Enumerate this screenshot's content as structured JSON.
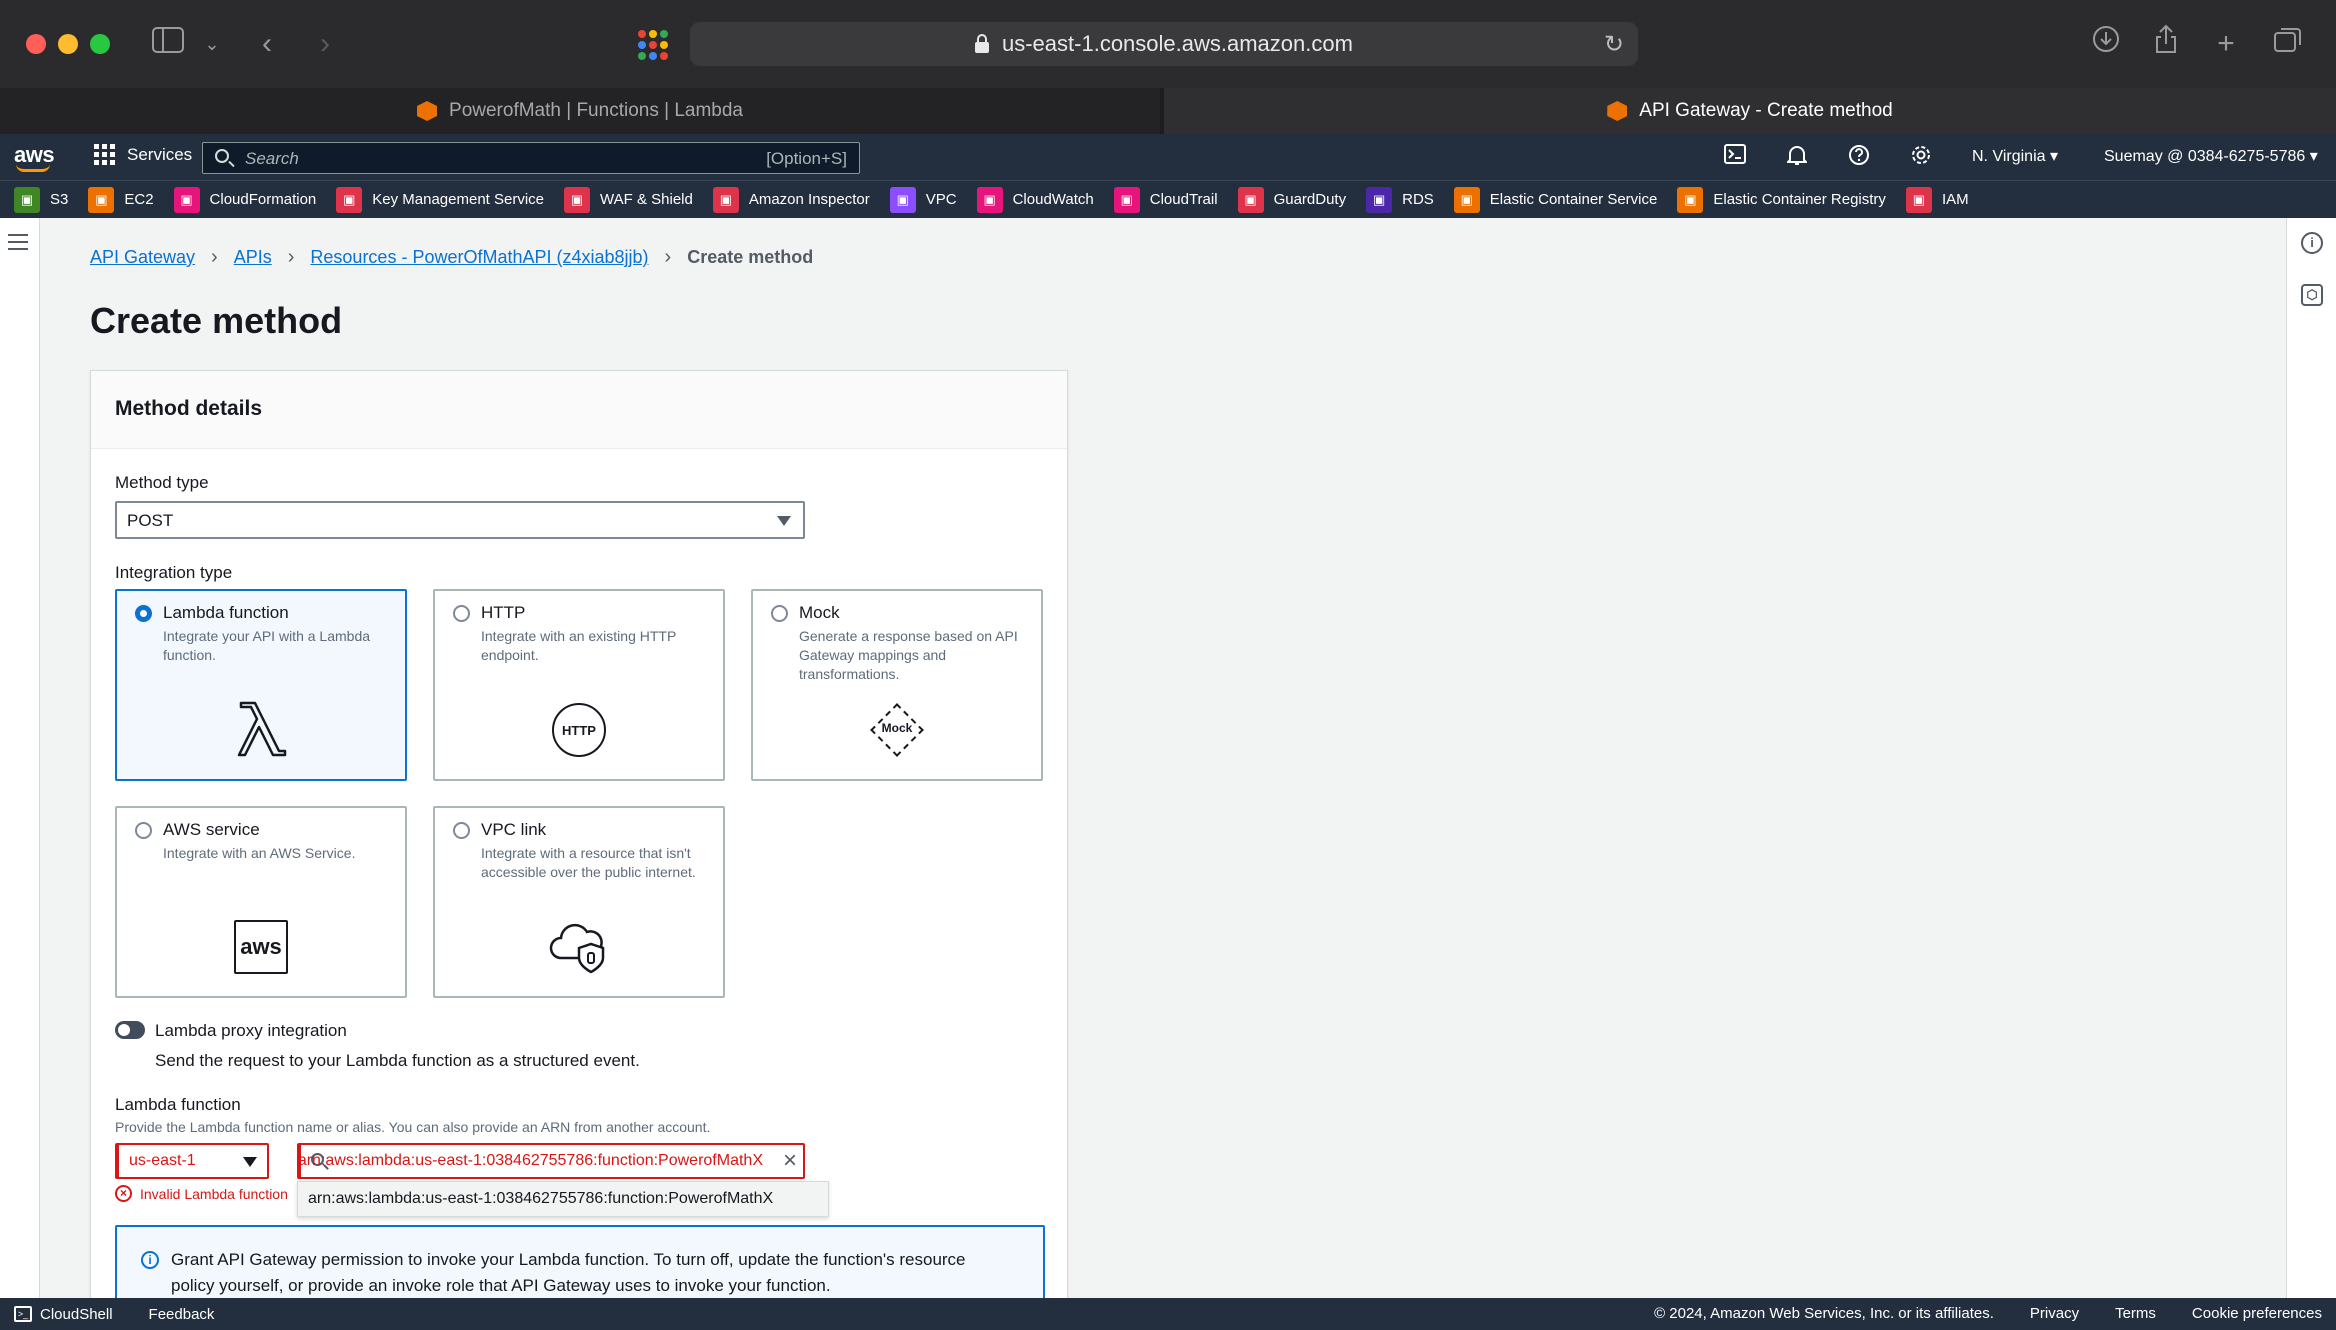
{
  "browser": {
    "url": "us-east-1.console.aws.amazon.com",
    "tabs": [
      {
        "label": "PowerofMath | Functions | Lambda"
      },
      {
        "label": "API Gateway - Create method"
      }
    ]
  },
  "aws_header": {
    "logo": "aws",
    "services_label": "Services",
    "search_placeholder": "Search",
    "search_shortcut": "[Option+S]",
    "region": "N. Virginia",
    "account": "Suemay @ 0384-6275-5786"
  },
  "favorites": [
    {
      "label": "S3",
      "color": "#3f8624"
    },
    {
      "label": "EC2",
      "color": "#ed7100"
    },
    {
      "label": "CloudFormation",
      "color": "#e7157b"
    },
    {
      "label": "Key Management Service",
      "color": "#dd344c"
    },
    {
      "label": "WAF & Shield",
      "color": "#dd344c"
    },
    {
      "label": "Amazon Inspector",
      "color": "#dd344c"
    },
    {
      "label": "VPC",
      "color": "#8c4fff"
    },
    {
      "label": "CloudWatch",
      "color": "#e7157b"
    },
    {
      "label": "CloudTrail",
      "color": "#e7157b"
    },
    {
      "label": "GuardDuty",
      "color": "#dd344c"
    },
    {
      "label": "RDS",
      "color": "#4d27aa"
    },
    {
      "label": "Elastic Container Service",
      "color": "#ed7100"
    },
    {
      "label": "Elastic Container Registry",
      "color": "#ed7100"
    },
    {
      "label": "IAM",
      "color": "#dd344c"
    }
  ],
  "breadcrumb": {
    "items": [
      "API Gateway",
      "APIs",
      "Resources - PowerOfMathAPI (z4xiab8jjb)"
    ],
    "current": "Create method"
  },
  "page_title": "Create method",
  "method_details": {
    "heading": "Method details",
    "method_type_label": "Method type",
    "method_type_value": "POST",
    "integration_type_label": "Integration type",
    "integration_types": [
      {
        "title": "Lambda function",
        "desc": "Integrate your API with a Lambda function.",
        "selected": true,
        "icon": "lambda-icon"
      },
      {
        "title": "HTTP",
        "desc": "Integrate with an existing HTTP endpoint.",
        "selected": false,
        "icon": "http-icon",
        "icon_text": "HTTP"
      },
      {
        "title": "Mock",
        "desc": "Generate a response based on API Gateway mappings and transformations.",
        "selected": false,
        "icon": "mock-icon",
        "icon_text": "Mock"
      },
      {
        "title": "AWS service",
        "desc": "Integrate with an AWS Service.",
        "selected": false,
        "icon": "aws-service-icon",
        "icon_text": "aws"
      },
      {
        "title": "VPC link",
        "desc": "Integrate with a resource that isn't accessible over the public internet.",
        "selected": false,
        "icon": "vpc-link-icon"
      }
    ],
    "proxy_toggle_label": "Lambda proxy integration",
    "proxy_toggle_desc": "Send the request to your Lambda function as a structured event.",
    "lambda_function_label": "Lambda function",
    "lambda_function_desc": "Provide the Lambda function name or alias. You can also provide an ARN from another account.",
    "region_value": "us-east-1",
    "function_input_value": "arn:aws:lambda:us-east-1:038462755786:function:PowerofMathX",
    "suggestion": "arn:aws:lambda:us-east-1:038462755786:function:PowerofMathX",
    "error_text": "Invalid Lambda function",
    "info_text": "Grant API Gateway permission to invoke your Lambda function. To turn off, update the function's resource policy yourself, or provide an invoke role that API Gateway uses to invoke your function."
  },
  "footer": {
    "cloudshell": "CloudShell",
    "feedback": "Feedback",
    "copyright": "© 2024, Amazon Web Services, Inc. or its affiliates.",
    "privacy": "Privacy",
    "terms": "Terms",
    "cookies": "Cookie preferences"
  }
}
